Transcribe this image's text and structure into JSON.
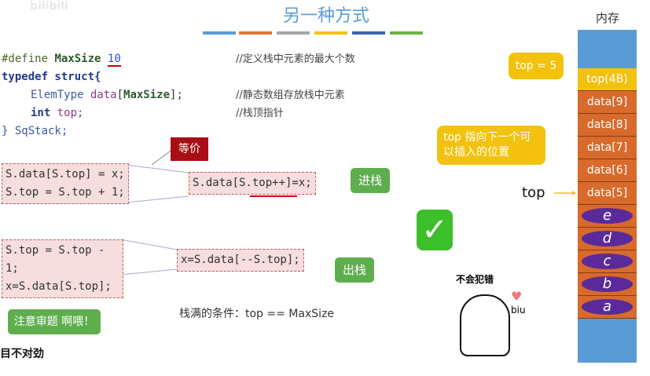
{
  "watermark": "bilibili",
  "title": "另一种方式",
  "colors": {
    "accent_bars": [
      "#5b9bd5",
      "#d9773a",
      "#a5a5a5",
      "#f2c20f",
      "#3b64ad",
      "#6cb346"
    ],
    "memory_blue": "#5b9bd5",
    "data_orange": "#d86a2b",
    "element_purple": "#5b2a9a",
    "top_yellow": "#f2c20f",
    "green_label": "#5fae4e",
    "equiv_red": "#a80f14"
  },
  "code": {
    "line1_a": "#define ",
    "line1_b": "MaxSize",
    "line1_c": "10",
    "line2": "typedef struct{",
    "line3_a": "ElemType ",
    "line3_b": "data",
    "line3_c": "[",
    "line3_d": "MaxSize",
    "line3_e": "];",
    "line4_a": "int ",
    "line4_b": "top;",
    "line5": "} SqStack;"
  },
  "comments": [
    "//定义栈中元素的最大个数",
    "//静态数组存放栈中元素",
    "//栈顶指针"
  ],
  "equiv_label": "等价",
  "push": {
    "long1": "S.data[S.top] = x;",
    "long2": "S.top = S.top + 1;",
    "short": "S.data[S.top++]=x;",
    "label": "进栈"
  },
  "pop": {
    "long1": "S.top = S.top - 1;",
    "long2": "x=S.data[S.top];",
    "short": "x=S.data[--S.top];",
    "label": "出栈"
  },
  "full_condition": "栈满的条件：top == MaxSize",
  "warning": "注意审题 啊喂！",
  "cut_text": "目不对劲",
  "no_mistake": "不会犯错",
  "biu": "biu",
  "check_icon": "✓",
  "memory": {
    "header": "内存",
    "top_cell": "top(4B)",
    "data_cells": [
      "data[9]",
      "data[8]",
      "data[7]",
      "data[6]",
      "data[5]"
    ],
    "elements": [
      "e",
      "d",
      "c",
      "b",
      "a"
    ]
  },
  "top_eq": "top = 5",
  "top_callout": "top 指向下一个可以插入的位置",
  "top_pointer": "top"
}
